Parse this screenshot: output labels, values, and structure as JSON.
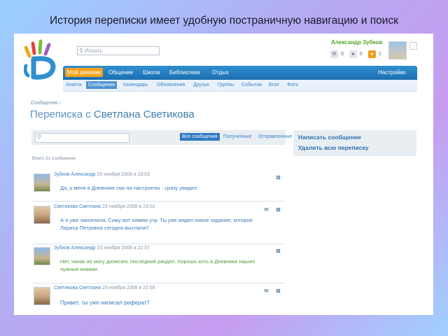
{
  "slide_title": "История переписки имеет удобную постраничную навигацию и поиск",
  "header": {
    "search_placeholder": "Искать",
    "user_name": "Александр Зубков",
    "counters": [
      {
        "icon": "envelope-icon",
        "value": "0"
      },
      {
        "icon": "person-icon",
        "value": "0"
      },
      {
        "icon": "friends-icon",
        "value": "2"
      }
    ]
  },
  "nav": {
    "items": [
      "Мой дневник",
      "Общение",
      "Школа",
      "Библиотека",
      "Отдых"
    ],
    "settings": "Настройки"
  },
  "subnav": {
    "items": [
      "Анкета",
      "Сообщения",
      "Календарь",
      "Обновления",
      "Друзья",
      "Группы",
      "События",
      "Блог",
      "Фото"
    ]
  },
  "breadcrumb": "Сообщения  ›",
  "page_title": {
    "prefix": "Переписка с ",
    "name": "Светлана Светикова"
  },
  "filter": {
    "tabs": [
      "Все сообщения",
      "Полученные",
      "Отправленные"
    ]
  },
  "message_count": "Всего 31 сообщение",
  "side_panel": {
    "write": "Написать сообщение",
    "delete_all": "Удалить всю переписку"
  },
  "messages": [
    {
      "author": "Зубков Александр",
      "date": "23 ноября 2008 в 23:03",
      "lines": [
        "Да, у меня в Дневнике смс-ки настроены - сразу увидел."
      ]
    },
    {
      "author": "Светикова Светлана",
      "date": "23 ноября 2008 в 23:01",
      "lines": [
        "А я уже закончила. Сижу вот химию учу. Ты уже видел новое задание, которое",
        "Лариса Петровна сегодня выслала?"
      ]
    },
    {
      "author": "Зубков Александр",
      "date": "23 ноября 2008 в 22:57",
      "lines": [
        "Нет, никак не могу дописать последний раздел. Хорошо хоть в Дневнике нашел",
        "нужные книжки."
      ]
    },
    {
      "author": "Светикова Светлана",
      "date": "23 ноября 2008 в 22:55",
      "lines": [
        "Привет, ты уже написал реферат?"
      ]
    }
  ],
  "colors": {
    "nav_bg": "#2077bc",
    "nav_active": "#f5a21d",
    "link": "#3a82c4",
    "green_text": "#4e9a38"
  }
}
